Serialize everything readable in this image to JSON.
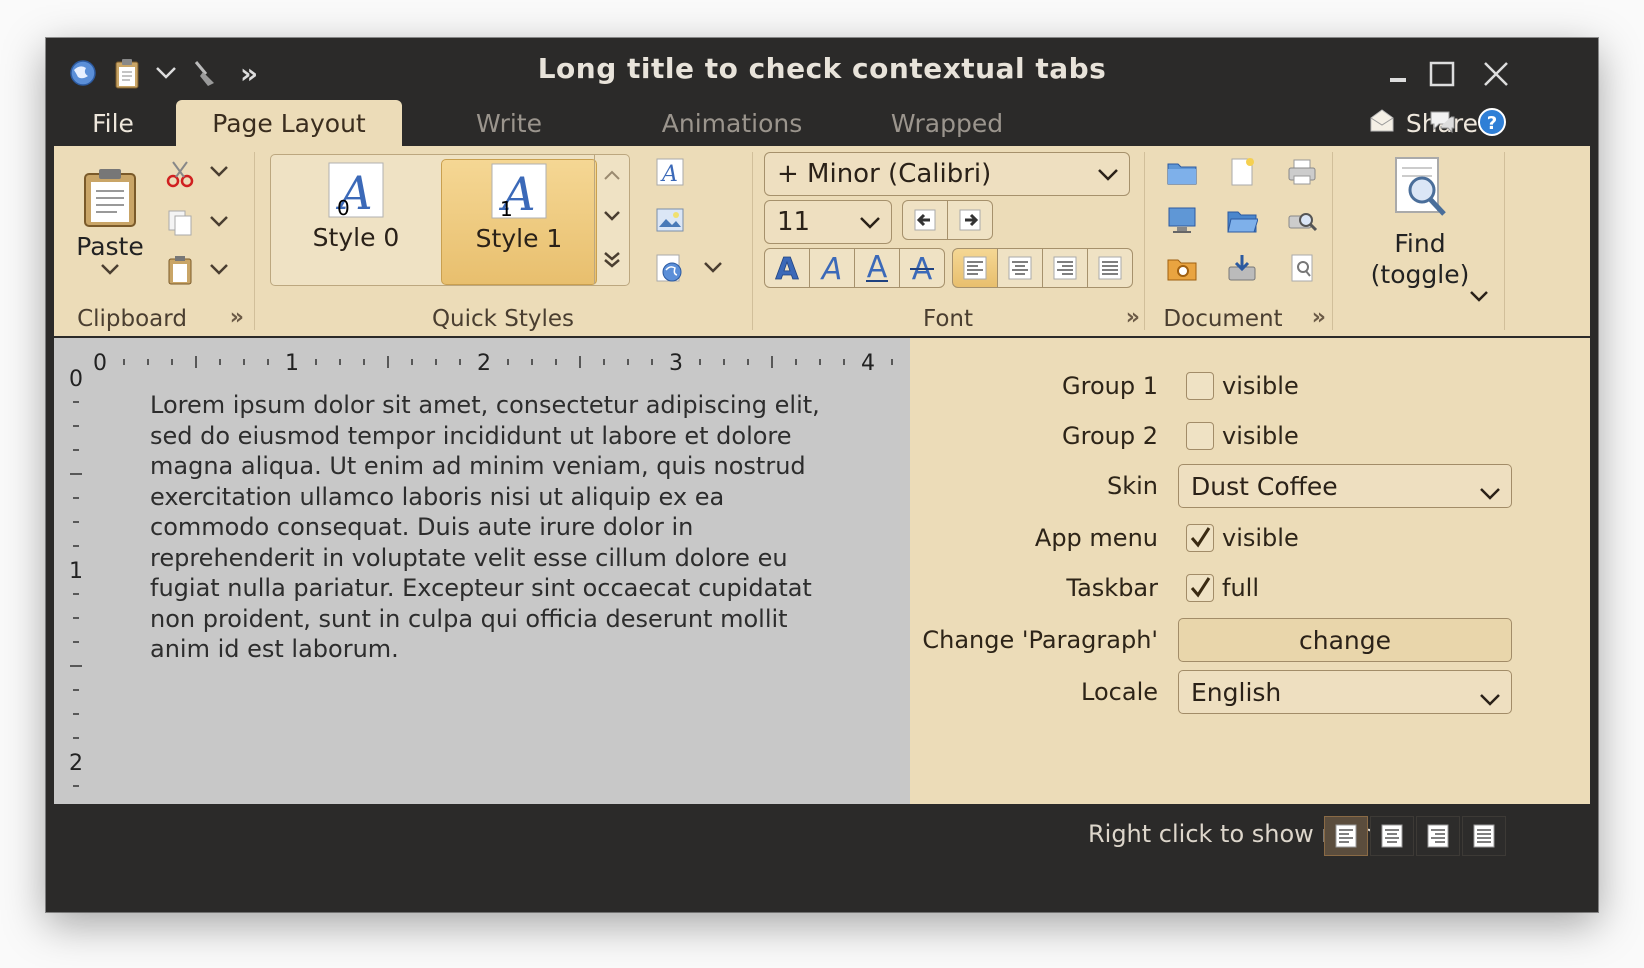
{
  "window": {
    "title": "Long title to check contextual tabs",
    "quick_access": [
      "globe-icon",
      "clipboard-icon",
      "chevron-down-icon",
      "broom-icon",
      "double-chevron-icon"
    ]
  },
  "tabs": {
    "file": "File",
    "items": [
      "Page Layout",
      "Write",
      "Animations",
      "Wrapped"
    ],
    "active": "Page Layout"
  },
  "share": {
    "label": "Share"
  },
  "ribbon": {
    "clipboard": {
      "title": "Clipboard",
      "paste_label": "Paste"
    },
    "quick_styles": {
      "title": "Quick Styles",
      "items": [
        {
          "label": "Style 0",
          "num": "0"
        },
        {
          "label": "Style 1",
          "num": "1"
        }
      ],
      "selected": "Style 1"
    },
    "font": {
      "title": "Font",
      "family": "+ Minor (Calibri)",
      "size": "11"
    },
    "document": {
      "title": "Document"
    },
    "find": {
      "line1": "Find",
      "line2": "(toggle)"
    }
  },
  "ruler": {
    "top": [
      "0",
      "1",
      "2",
      "3",
      "4"
    ],
    "left": [
      "0",
      "1",
      "2"
    ]
  },
  "document_text": "Lorem ipsum dolor sit amet, consectetur adipiscing elit, sed do eiusmod tempor incididunt ut labore et dolore magna aliqua. Ut enim ad minim veniam, quis nostrud exercitation ullamco laboris nisi ut aliquip ex ea commodo consequat. Duis aute irure dolor in reprehenderit in voluptate velit esse cillum dolore eu fugiat nulla pariatur. Excepteur sint occaecat cupidatat non proident, sunt in culpa qui officia deserunt mollit anim id est laborum.",
  "panel": {
    "group1": {
      "label": "Group 1",
      "text": "visible",
      "checked": false
    },
    "group2": {
      "label": "Group 2",
      "text": "visible",
      "checked": false
    },
    "skin": {
      "label": "Skin",
      "value": "Dust Coffee"
    },
    "app_menu": {
      "label": "App menu",
      "text": "visible",
      "checked": true
    },
    "taskbar": {
      "label": "Taskbar",
      "text": "full",
      "checked": true
    },
    "change_paragraph": {
      "label": "Change 'Paragraph'",
      "button": "change"
    },
    "locale": {
      "label": "Locale",
      "value": "English"
    }
  },
  "status": {
    "text": "Right click to show menu"
  },
  "colors": {
    "ribbon": "#ecdcb8",
    "frame": "#2b2a29",
    "selected": "#e8bf6e",
    "doc": "#c8c8c8"
  }
}
